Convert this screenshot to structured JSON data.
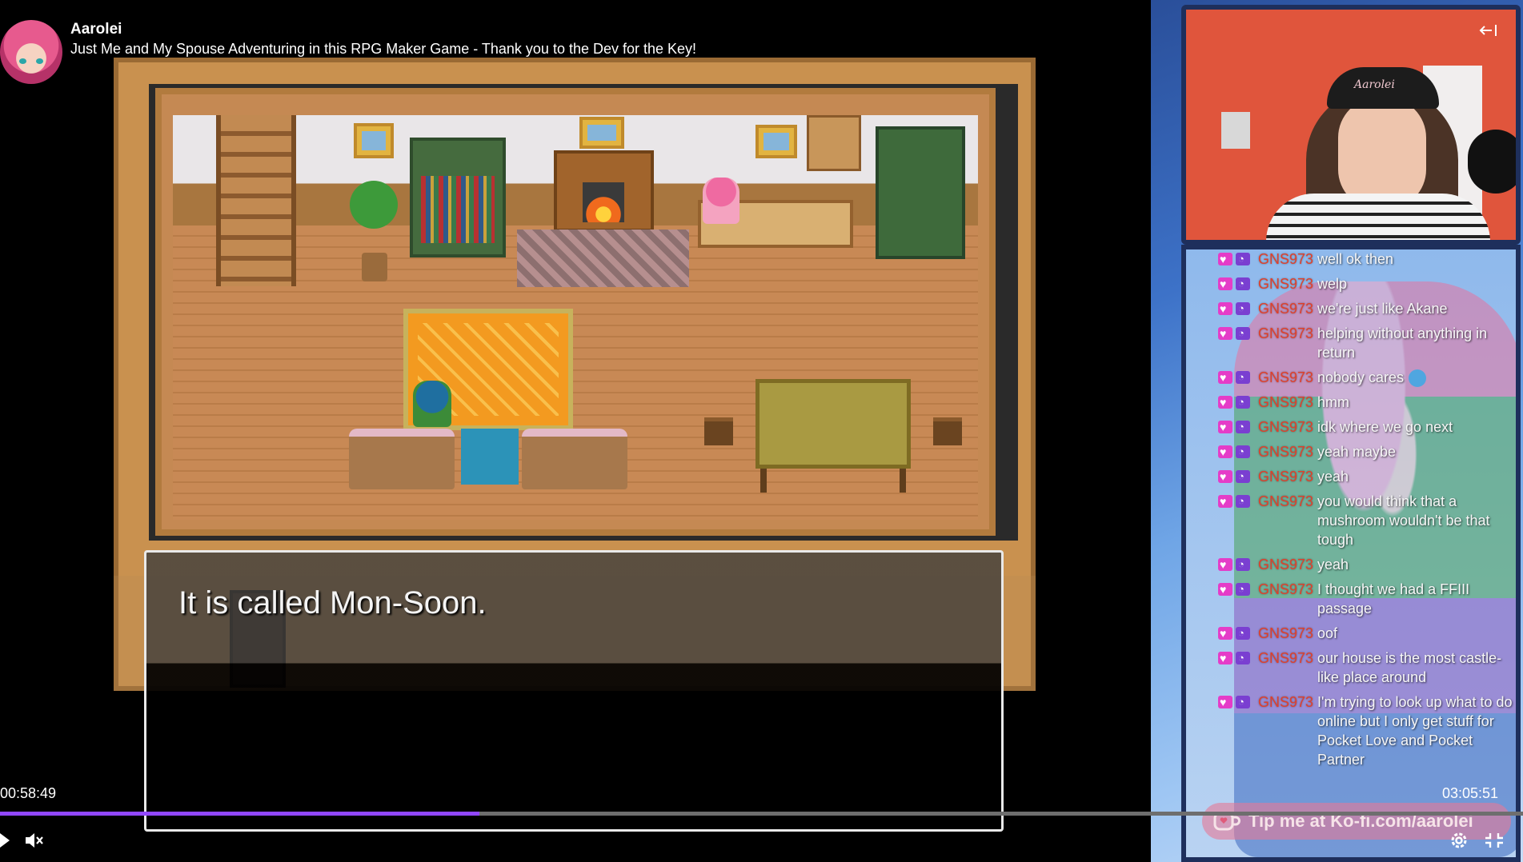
{
  "stream": {
    "channel_name": "Aarolei",
    "title": "Just Me and My Spouse Adventuring in this RPG Maker Game - Thank you to the Dev for the Key!"
  },
  "game": {
    "dialogue": "It is called Mon-Soon."
  },
  "player": {
    "current_time": "00:58:49",
    "total_time": "03:05:51",
    "progress_fraction": 0.315,
    "icons": [
      "play-icon",
      "volume-muted-icon",
      "settings-icon",
      "exit-fullscreen-icon"
    ]
  },
  "webcam": {
    "cap_text": "Aarolei"
  },
  "chat": {
    "username": "GNS973",
    "messages": [
      {
        "user": "GNS973",
        "text": "well ok then"
      },
      {
        "user": "GNS973",
        "text": "welp"
      },
      {
        "user": "GNS973",
        "text": "we're just like Akane"
      },
      {
        "user": "GNS973",
        "text": "helping without anything in return"
      },
      {
        "user": "GNS973",
        "text": "nobody cares"
      },
      {
        "user": "GNS973",
        "text": "hmm"
      },
      {
        "user": "GNS973",
        "text": "idk where we go next"
      },
      {
        "user": "GNS973",
        "text": "yeah maybe"
      },
      {
        "user": "GNS973",
        "text": "yeah"
      },
      {
        "user": "GNS973",
        "text": "you would think that a mushroom wouldn't be that tough"
      },
      {
        "user": "GNS973",
        "text": "yeah"
      },
      {
        "user": "GNS973",
        "text": "I thought we had a FFIII passage"
      },
      {
        "user": "GNS973",
        "text": "oof"
      },
      {
        "user": "GNS973",
        "text": "our house is the most castle-like place around"
      },
      {
        "user": "GNS973",
        "text": "I'm trying to look up what to do online but I only get stuff for Pocket Love and Pocket Partner"
      }
    ]
  },
  "kofi": {
    "text": "Tip me at Ko-fi.com/aarolei"
  },
  "colors": {
    "accent": "#9147ff",
    "chat_username": "#e0402b",
    "badge_heart": "#e53cc8",
    "badge_sub": "#7a3fd1"
  }
}
